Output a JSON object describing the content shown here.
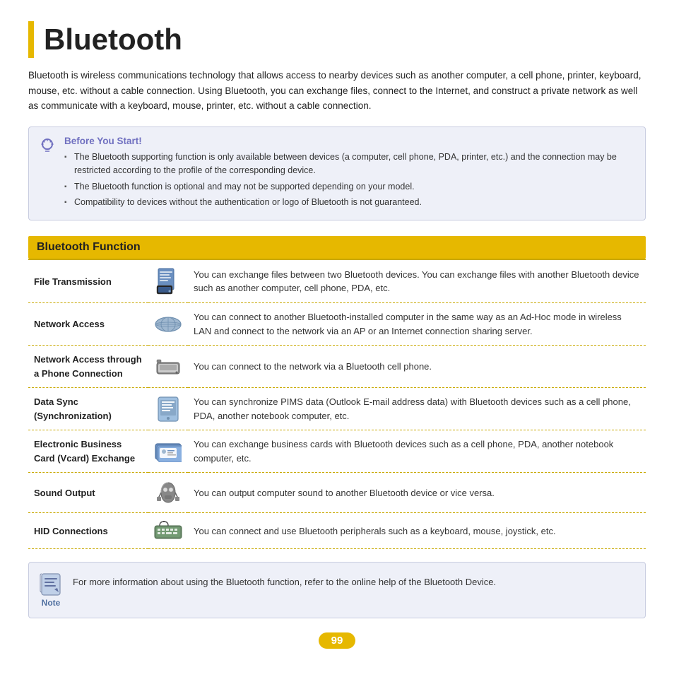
{
  "page": {
    "title": "Bluetooth",
    "intro": "Bluetooth is wireless communications technology that allows access to nearby devices such as another computer, a cell phone, printer, keyboard, mouse, etc. without a cable connection. Using Bluetooth, you can exchange files, connect to the Internet, and construct a private network as well as communicate with a keyboard, mouse, printer, etc. without a cable connection.",
    "info_box": {
      "title": "Before You Start!",
      "items": [
        "The Bluetooth supporting function is only available between devices (a computer, cell phone, PDA, printer, etc.) and the connection may be restricted according to the profile of the corresponding device.",
        "The Bluetooth function is optional and may not be supported depending on your model.",
        "Compatibility to devices without the authentication or logo of Bluetooth is not guaranteed."
      ]
    },
    "section_header": "Bluetooth Function",
    "features": [
      {
        "name": "File Transmission",
        "icon": "file-transmission-icon",
        "desc": "You can exchange files between two Bluetooth devices.\nYou can exchange files with another Bluetooth device such as another computer, cell phone, PDA, etc."
      },
      {
        "name": "Network Access",
        "icon": "network-access-icon",
        "desc": "You can connect to another Bluetooth-installed computer in the same way as an Ad-Hoc mode in wireless LAN and connect to the network via an AP or an Internet connection sharing server."
      },
      {
        "name": "Network Access through a Phone Connection",
        "icon": "phone-connection-icon",
        "desc": "You can connect to the network via a Bluetooth cell phone."
      },
      {
        "name": "Data Sync (Synchronization)",
        "icon": "data-sync-icon",
        "desc": "You can synchronize PIMS data (Outlook E-mail address data) with Bluetooth devices such as a cell phone, PDA, another notebook computer, etc."
      },
      {
        "name": "Electronic Business Card (Vcard) Exchange",
        "icon": "vcard-icon",
        "desc": "You can exchange business cards with Bluetooth devices such as a cell phone, PDA, another notebook computer, etc."
      },
      {
        "name": "Sound Output",
        "icon": "sound-output-icon",
        "desc": "You can output computer sound to another Bluetooth device or vice versa."
      },
      {
        "name": "HID Connections",
        "icon": "hid-icon",
        "desc": "You can connect and use Bluetooth peripherals such as a keyboard, mouse, joystick, etc."
      }
    ],
    "note": {
      "label": "Note",
      "text": "For more information about using the Bluetooth function, refer to the online help of the Bluetooth Device."
    },
    "page_number": "99"
  }
}
